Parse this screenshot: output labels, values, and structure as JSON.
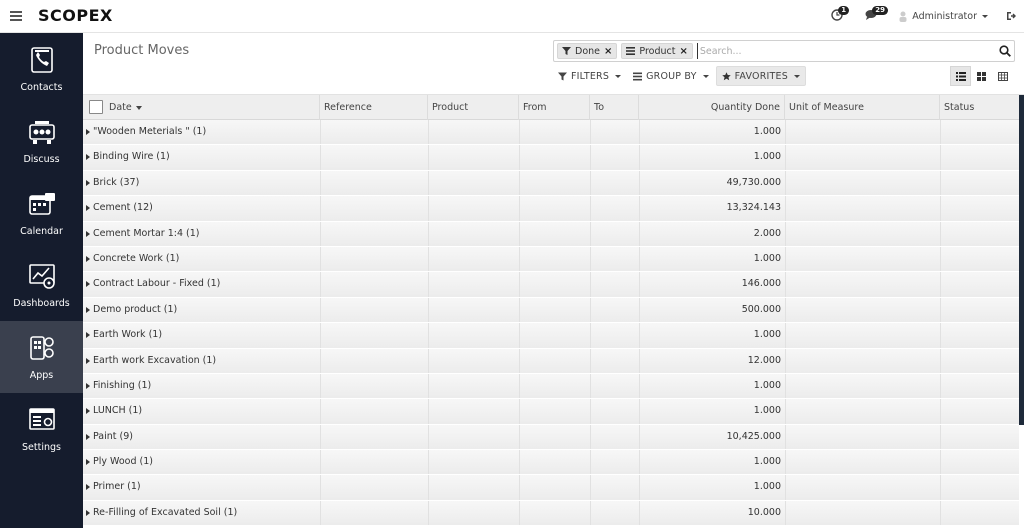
{
  "topbar": {
    "logo": "SCOPEX",
    "activity_count": "1",
    "messages_count": "29",
    "user_name": "Administrator"
  },
  "sidebar": {
    "items": [
      {
        "label": "Contacts",
        "icon": "contacts-icon"
      },
      {
        "label": "Discuss",
        "icon": "discuss-icon"
      },
      {
        "label": "Calendar",
        "icon": "calendar-icon"
      },
      {
        "label": "Dashboards",
        "icon": "dashboards-icon"
      },
      {
        "label": "Apps",
        "icon": "apps-icon",
        "active": true
      },
      {
        "label": "Settings",
        "icon": "settings-icon"
      }
    ]
  },
  "control_panel": {
    "title": "Product Moves",
    "facets": [
      {
        "label": "Done",
        "icon": "filter-icon"
      },
      {
        "label": "Product",
        "icon": "group-by-icon"
      }
    ],
    "search_placeholder": "Search...",
    "filters_label": "FILTERS",
    "group_by_label": "GROUP BY",
    "favorites_label": "FAVORITES"
  },
  "table": {
    "columns": [
      "Date",
      "Reference",
      "Product",
      "From",
      "To",
      "Quantity Done",
      "Unit of Measure",
      "Status"
    ],
    "groups": [
      {
        "name": "\"Wooden Meterials \" (1)",
        "qty": "1.000"
      },
      {
        "name": "Binding Wire (1)",
        "qty": "1.000"
      },
      {
        "name": "Brick (37)",
        "qty": "49,730.000"
      },
      {
        "name": "Cement (12)",
        "qty": "13,324.143"
      },
      {
        "name": "Cement Mortar 1:4 (1)",
        "qty": "2.000"
      },
      {
        "name": "Concrete Work (1)",
        "qty": "1.000"
      },
      {
        "name": "Contract Labour - Fixed (1)",
        "qty": "146.000"
      },
      {
        "name": "Demo product (1)",
        "qty": "500.000"
      },
      {
        "name": "Earth Work (1)",
        "qty": "1.000"
      },
      {
        "name": "Earth work Excavation (1)",
        "qty": "12.000"
      },
      {
        "name": "Finishing (1)",
        "qty": "1.000"
      },
      {
        "name": "LUNCH (1)",
        "qty": "1.000"
      },
      {
        "name": "Paint (9)",
        "qty": "10,425.000"
      },
      {
        "name": "Ply Wood (1)",
        "qty": "1.000"
      },
      {
        "name": "Primer (1)",
        "qty": "1.000"
      },
      {
        "name": "Re-Filling of Excavated Soil (1)",
        "qty": "10.000"
      }
    ]
  },
  "colors": {
    "sidebar_bg": "#151c2d",
    "sidebar_active": "#3a404e",
    "header_bg": "#eeeeee"
  }
}
